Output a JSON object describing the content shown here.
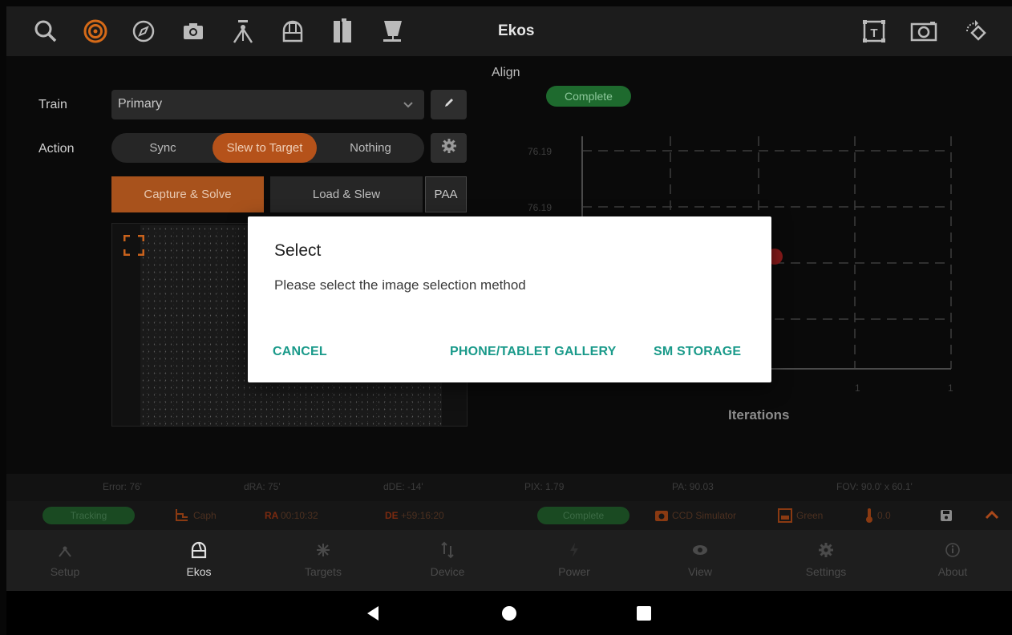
{
  "toolbar": {
    "title": "Ekos",
    "left_icons": [
      "search-icon",
      "target-icon",
      "compass-icon",
      "camera-icon",
      "tripod-icon",
      "dome-icon",
      "filter-wheel-icon",
      "telescope-icon"
    ],
    "right_icons": [
      "text-frame-icon",
      "frame-icon",
      "rotate-icon"
    ]
  },
  "align": {
    "train_label": "Train",
    "train_value": "Primary",
    "action_label": "Action",
    "actions": [
      "Sync",
      "Slew to Target",
      "Nothing"
    ],
    "active_action": "Slew to Target",
    "capture_button": "Capture & Solve",
    "load_button": "Load & Slew",
    "paa_button": "PAA",
    "panel_title": "Align",
    "status_pill": "Complete",
    "chart": {
      "y_tick_1": "76.19",
      "y_tick_2": "76.19",
      "x_tick_1": "1",
      "x_tick_2": "1",
      "x_label": "Iterations"
    }
  },
  "status_row": {
    "error": "Error: 76'",
    "dra": "dRA: 75'",
    "dde": "dDE: -14'",
    "pix": "PIX: 1.79",
    "pa": "PA: 90.03",
    "fov": "FOV: 90.0' x 60.1'"
  },
  "mount_row": {
    "tracking": "Tracking",
    "target": "Caph",
    "ra_label": "RA",
    "ra_value": "00:10:32",
    "de_label": "DE",
    "de_value": "+59:16:20",
    "align_status": "Complete",
    "camera": "CCD Simulator",
    "filter": "Green",
    "temperature": "0.0"
  },
  "bottom_nav": {
    "items": [
      {
        "label": "Setup",
        "icon": "setup-icon"
      },
      {
        "label": "Ekos",
        "icon": "ekos-icon"
      },
      {
        "label": "Targets",
        "icon": "targets-icon"
      },
      {
        "label": "Device",
        "icon": "device-icon"
      },
      {
        "label": "Power",
        "icon": "power-icon"
      },
      {
        "label": "View",
        "icon": "view-icon"
      },
      {
        "label": "Settings",
        "icon": "settings-icon"
      },
      {
        "label": "About",
        "icon": "about-icon"
      }
    ],
    "active": "Ekos"
  },
  "dialog": {
    "title": "Select",
    "message": "Please select the image selection method",
    "cancel": "CANCEL",
    "gallery": "PHONE/TABLET GALLERY",
    "storage": "SM STORAGE"
  },
  "colors": {
    "accent_orange": "#b5521a",
    "complete_green": "#1e6a2e",
    "dialog_button": "#1a9a8a"
  }
}
